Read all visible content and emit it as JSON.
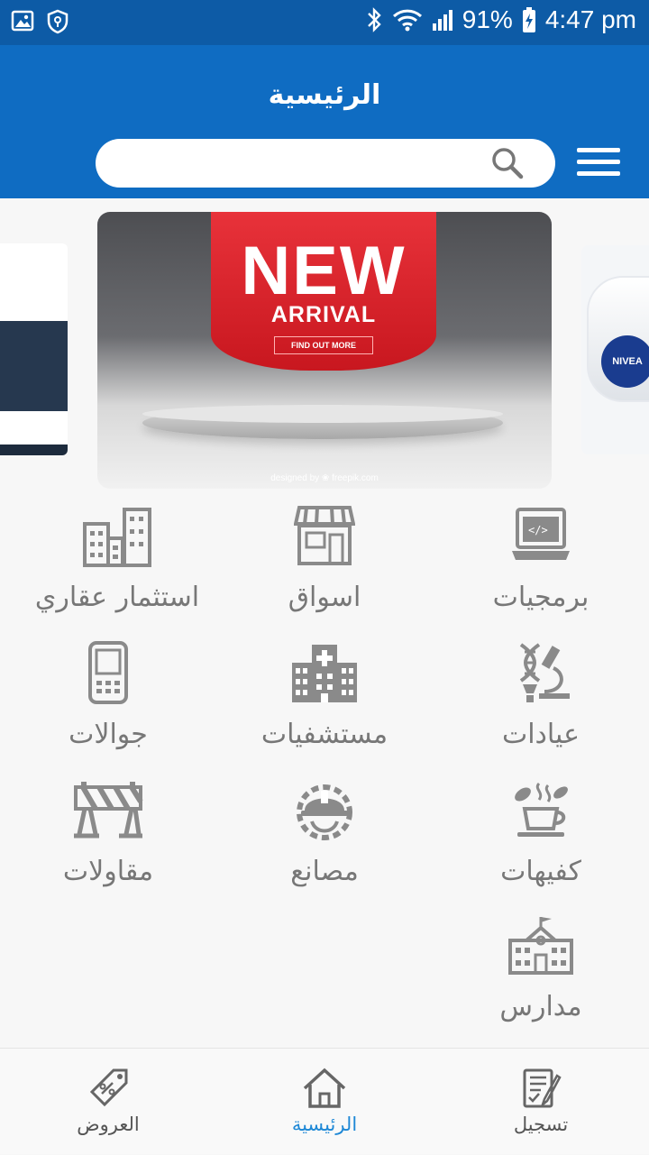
{
  "status_bar": {
    "battery": "91%",
    "time": "4:47 pm"
  },
  "header": {
    "title": "الرئيسية",
    "search_placeholder": ""
  },
  "banner": {
    "headline": "NEW",
    "subheadline": "ARRIVAL",
    "cta": "FIND OUT MORE",
    "credit": "designed by ❀ freepik.com",
    "side_brand": "NIVEA"
  },
  "categories": [
    {
      "label": "برمجيات",
      "icon": "laptop-code-icon"
    },
    {
      "label": "اسواق",
      "icon": "storefront-icon"
    },
    {
      "label": "استثمار عقاري",
      "icon": "buildings-icon"
    },
    {
      "label": "عيادات",
      "icon": "dna-microscope-icon"
    },
    {
      "label": "مستشفيات",
      "icon": "hospital-icon"
    },
    {
      "label": "جوالات",
      "icon": "mobile-phone-icon"
    },
    {
      "label": "كفيهات",
      "icon": "coffee-cup-icon"
    },
    {
      "label": "مصانع",
      "icon": "hardhat-gear-icon"
    },
    {
      "label": "مقاولات",
      "icon": "road-barrier-icon"
    },
    {
      "label": "مدارس",
      "icon": "school-icon"
    }
  ],
  "bottom_nav": [
    {
      "label": "تسجيل",
      "icon": "register-form-icon",
      "active": false
    },
    {
      "label": "الرئيسية",
      "icon": "home-icon",
      "active": true
    },
    {
      "label": "العروض",
      "icon": "discount-tag-icon",
      "active": false
    }
  ],
  "colors": {
    "status_bar": "#0d5ba6",
    "app_bar": "#0f6cc2",
    "active_tab": "#1e88d6",
    "icon_gray": "#8a8a8a"
  }
}
